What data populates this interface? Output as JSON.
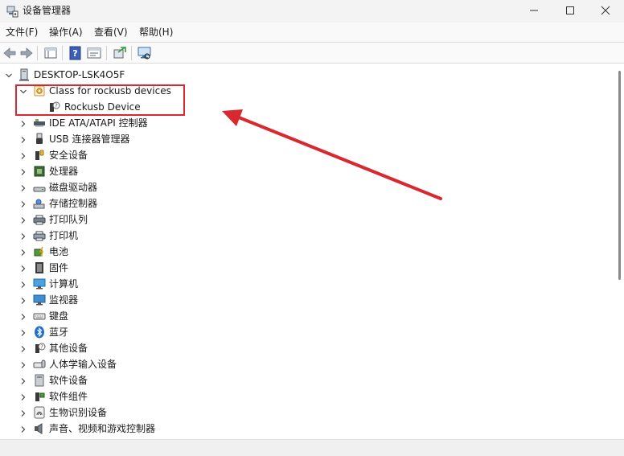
{
  "window": {
    "title": "设备管理器"
  },
  "menu": {
    "file": "文件(F)",
    "action": "操作(A)",
    "view": "查看(V)",
    "help": "帮助(H)"
  },
  "tree": {
    "root": "DESKTOP-LSK4O5F",
    "expanded_class": "Class for rockusb devices",
    "child": "Rockusb Device",
    "categories": [
      "IDE ATA/ATAPI 控制器",
      "USB 连接器管理器",
      "安全设备",
      "处理器",
      "磁盘驱动器",
      "存储控制器",
      "打印队列",
      "打印机",
      "电池",
      "固件",
      "计算机",
      "监视器",
      "键盘",
      "蓝牙",
      "其他设备",
      "人体学输入设备",
      "软件设备",
      "软件组件",
      "生物识别设备",
      "声音、视频和游戏控制器"
    ]
  },
  "colors": {
    "annotation": "#d9282f",
    "titlebar": "#f3f3f3",
    "icon_blue": "#1f6fd1"
  }
}
